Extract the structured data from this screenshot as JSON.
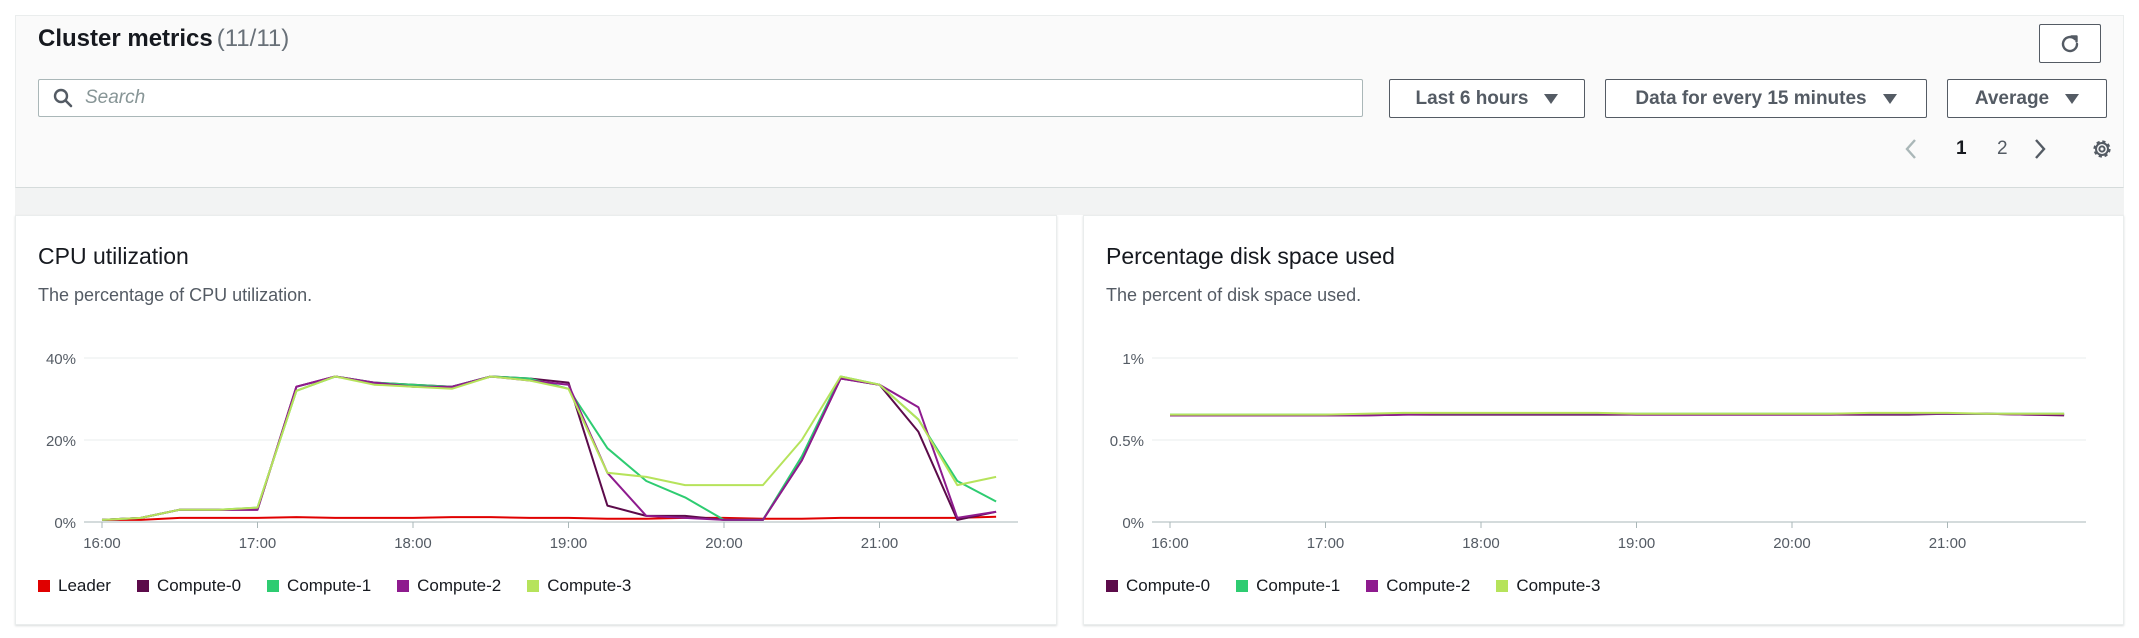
{
  "header": {
    "title": "Cluster metrics",
    "count": "(11/11)",
    "search_placeholder": "Search",
    "range_label": "Last 6 hours",
    "period_label": "Data for every 15 minutes",
    "stat_label": "Average"
  },
  "pagination": {
    "pages": [
      "1",
      "2"
    ],
    "current": "1"
  },
  "colors": {
    "Leader": "#e00000",
    "Compute-0": "#5c0b4a",
    "Compute-1": "#2ecc71",
    "Compute-2": "#8e1b8e",
    "Compute-3": "#b6e35b"
  },
  "chart_data": [
    {
      "type": "line",
      "title": "CPU utilization",
      "subtitle": "The percentage of CPU utilization.",
      "y_ticks": [
        "40%",
        "20%",
        "0%"
      ],
      "ylim": [
        0,
        40
      ],
      "x_ticks": [
        "16:00",
        "17:00",
        "18:00",
        "19:00",
        "20:00",
        "21:00"
      ],
      "x": [
        0,
        0.25,
        0.5,
        0.75,
        1,
        1.25,
        1.5,
        1.75,
        2,
        2.25,
        2.5,
        2.75,
        3,
        3.25,
        3.5,
        3.75,
        4,
        4.25,
        4.5,
        4.75,
        5,
        5.25,
        5.5,
        5.75
      ],
      "legend": [
        "Leader",
        "Compute-0",
        "Compute-1",
        "Compute-2",
        "Compute-3"
      ],
      "series": [
        {
          "name": "Leader",
          "values": [
            0.5,
            0.5,
            1,
            1,
            1,
            1.2,
            1,
            1,
            1,
            1.2,
            1.2,
            1,
            1,
            0.8,
            0.8,
            1,
            1,
            0.8,
            0.8,
            1,
            1,
            1,
            1,
            1.3
          ]
        },
        {
          "name": "Compute-0",
          "values": [
            0.5,
            1,
            3,
            3,
            3,
            33,
            35.5,
            34,
            33.5,
            33,
            35.5,
            35,
            34,
            4,
            1.5,
            1.5,
            0.5,
            0.5,
            15,
            35,
            33.5,
            22,
            0.5,
            2.5
          ]
        },
        {
          "name": "Compute-1",
          "values": [
            0.5,
            1,
            3,
            3,
            3.5,
            32,
            35.5,
            34,
            33.5,
            33,
            35.5,
            35,
            32.5,
            18,
            10,
            6,
            0.5,
            0.5,
            16,
            35.5,
            33.5,
            25,
            10,
            5
          ]
        },
        {
          "name": "Compute-2",
          "values": [
            0.5,
            1,
            3,
            3,
            3,
            33,
            35.5,
            34,
            33,
            33,
            35.5,
            34.5,
            33.5,
            12,
            1.5,
            1,
            0.5,
            0.5,
            15,
            35,
            33.5,
            28,
            1,
            2.5
          ]
        },
        {
          "name": "Compute-3",
          "values": [
            0.5,
            1,
            3,
            3,
            3.5,
            32,
            35.5,
            33.5,
            33,
            32.5,
            35.5,
            34.5,
            32.5,
            12,
            11,
            9,
            9,
            9,
            20,
            35.5,
            33.5,
            25,
            9,
            11
          ]
        }
      ]
    },
    {
      "type": "line",
      "title": "Percentage disk space used",
      "subtitle": "The percent of disk space used.",
      "y_ticks": [
        "1%",
        "0.5%",
        "0%"
      ],
      "ylim": [
        0,
        1
      ],
      "x_ticks": [
        "16:00",
        "17:00",
        "18:00",
        "19:00",
        "20:00",
        "21:00"
      ],
      "x": [
        0,
        0.25,
        0.5,
        0.75,
        1,
        1.25,
        1.5,
        1.75,
        2,
        2.25,
        2.5,
        2.75,
        3,
        3.25,
        3.5,
        3.75,
        4,
        4.25,
        4.5,
        4.75,
        5,
        5.25,
        5.5,
        5.75
      ],
      "legend": [
        "Compute-0",
        "Compute-1",
        "Compute-2",
        "Compute-3"
      ],
      "series": [
        {
          "name": "Compute-0",
          "values": [
            0.65,
            0.65,
            0.65,
            0.65,
            0.65,
            0.65,
            0.655,
            0.655,
            0.655,
            0.655,
            0.655,
            0.655,
            0.655,
            0.655,
            0.655,
            0.655,
            0.655,
            0.655,
            0.655,
            0.655,
            0.66,
            0.66,
            0.655,
            0.65
          ]
        },
        {
          "name": "Compute-1",
          "values": [
            0.655,
            0.655,
            0.655,
            0.655,
            0.655,
            0.655,
            0.66,
            0.66,
            0.66,
            0.66,
            0.66,
            0.66,
            0.66,
            0.66,
            0.66,
            0.66,
            0.66,
            0.66,
            0.66,
            0.66,
            0.66,
            0.66,
            0.66,
            0.66
          ]
        },
        {
          "name": "Compute-2",
          "values": [
            0.65,
            0.65,
            0.65,
            0.65,
            0.65,
            0.65,
            0.655,
            0.66,
            0.66,
            0.66,
            0.66,
            0.66,
            0.655,
            0.655,
            0.655,
            0.655,
            0.655,
            0.655,
            0.66,
            0.66,
            0.66,
            0.66,
            0.655,
            0.655
          ]
        },
        {
          "name": "Compute-3",
          "values": [
            0.655,
            0.655,
            0.655,
            0.655,
            0.655,
            0.66,
            0.665,
            0.665,
            0.665,
            0.665,
            0.665,
            0.665,
            0.66,
            0.66,
            0.66,
            0.66,
            0.66,
            0.66,
            0.665,
            0.665,
            0.665,
            0.66,
            0.66,
            0.66
          ]
        }
      ]
    }
  ]
}
